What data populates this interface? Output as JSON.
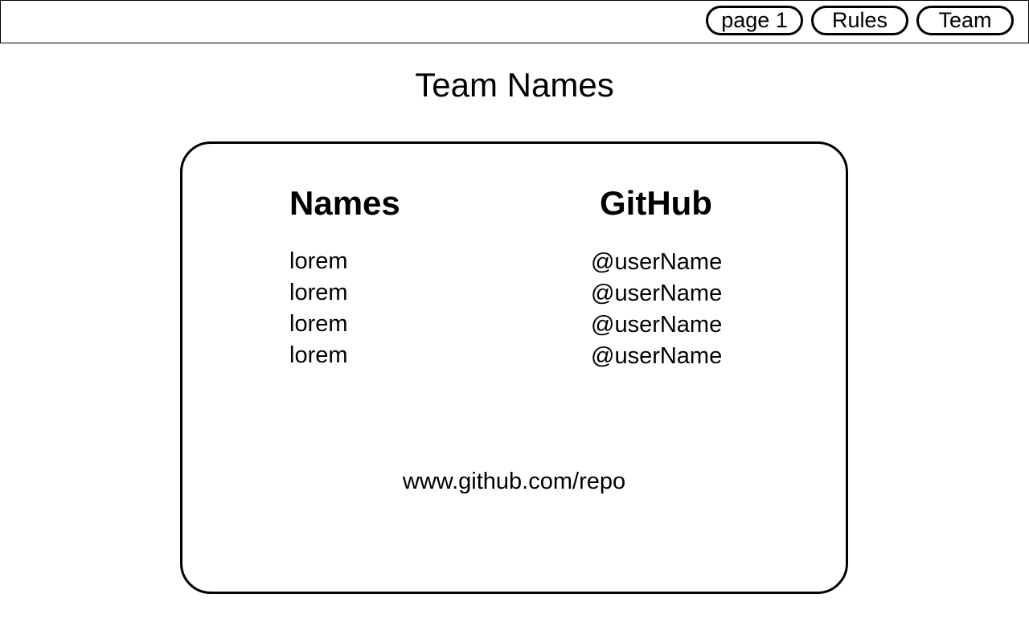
{
  "nav": {
    "items": [
      {
        "label": "page 1"
      },
      {
        "label": "Rules"
      },
      {
        "label": "Team"
      }
    ]
  },
  "page": {
    "title": "Team Names"
  },
  "team_card": {
    "names_heading": "Names",
    "github_heading": "GitHub",
    "names": [
      "lorem",
      "lorem",
      "lorem",
      "lorem"
    ],
    "usernames": [
      "@userName",
      "@userName",
      "@userName",
      "@userName"
    ],
    "repo_link": "www.github.com/repo"
  }
}
